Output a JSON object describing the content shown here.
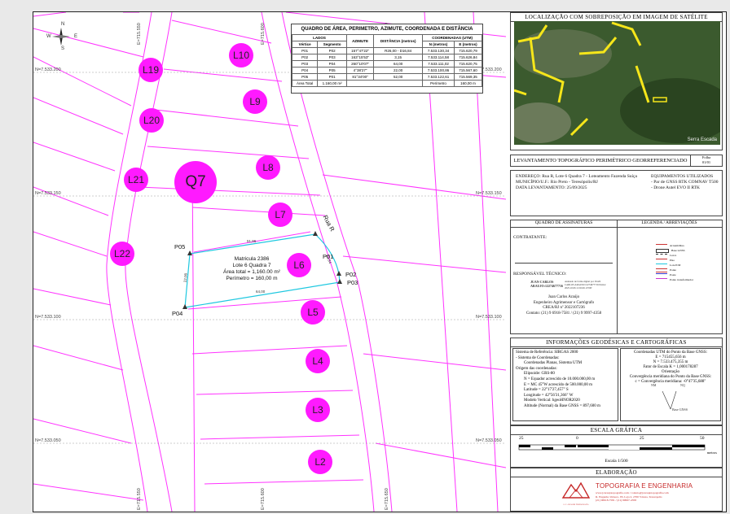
{
  "table": {
    "title": "QUADRO DE ÁREA, PERIMETRO, AZIMUTE, COORDENADA E DISTÂNCIA",
    "group_lados": "LADOS",
    "group_coords": "COORDENADAS (UTM)",
    "h_vertice": "Vértice",
    "h_segmento": "Segmento",
    "h_azimute": "AZIMUTE",
    "h_distancia": "DISTÂNCIA (metros)",
    "h_n": "N (metros)",
    "h_e": "E (metros)",
    "rows": [
      [
        "P01",
        "P02",
        "157°47'22\"",
        "R26,00 - D16,84",
        "7.533.130,34",
        "715.620,79"
      ],
      [
        "P02",
        "P03",
        "163°15'53\"",
        "3,15",
        "7.533.114,58",
        "715.626,84"
      ],
      [
        "P03",
        "P04",
        "260°10'07\"",
        "64,00",
        "7.533.111,02",
        "715.620,75"
      ],
      [
        "P04",
        "P05",
        "4°38'27\"",
        "22,00",
        "7.533.100,86",
        "715.567,60"
      ],
      [
        "P05",
        "P01",
        "81°34'00\"",
        "52,00",
        "7.533.122,61",
        "715.569,35"
      ]
    ],
    "total_label": "Área Total",
    "total_area": "1.160,00 m²",
    "perimetro_label": "Perímetro",
    "perimetro": "160,00 m"
  },
  "map": {
    "lots": [
      "L10",
      "L19",
      "L9",
      "L20",
      "L8",
      "L21",
      "Q7",
      "L7",
      "L22",
      "L6",
      "L5",
      "L4",
      "L3",
      "L2"
    ],
    "street": "Rua R",
    "vertices": [
      "P01",
      "P02",
      "P03",
      "P04",
      "P05"
    ],
    "matricula": [
      "Matricula 2386",
      "Lote 6 Quadra 7",
      "Área total = 1,160.00 m²",
      "Perímetro = 160,00 m"
    ],
    "dists": [
      "51,96",
      "22,84",
      "64,00",
      "22,00"
    ],
    "grid_n": [
      "N=7.533.200",
      "N=7.533.150",
      "N=7.533.100",
      "N=7.533.050"
    ],
    "grid_e": [
      "E=715.550",
      "E=715.600",
      "E=715.650"
    ],
    "north": [
      "N",
      "S",
      "W",
      "E"
    ]
  },
  "panel": {
    "sat_title": "LOCALIZAÇÃO COM SOBREPOSIÇÃO EM IMAGEM DE SATÉLITE",
    "sat_caption": "Serra Escada",
    "levant_title": "LEVANTAMENTO TOPOGRÁFICO PERIMÉTRICO GEORREFERENCIADO",
    "folha_label": "Folha",
    "folha": "01/01",
    "endereco": "ENDEREÇO: Rua R, Lote 6 Quadra 7 - Loteamento Fazenda Suíça",
    "municipio": "MUNICÍPIO/U.F.: Rio Preto - Teresópolis/RJ",
    "data": "DATA LEVANTAMENTO: 25/09/2025",
    "equip_title": "EQUIPAMENTOS UTILIZADOS",
    "equip1": "- Par de GNSS RTK COMNAV T500",
    "equip2": "- Drone Autel EVO II RTK",
    "assin_title": "QUADRO DE ASSINATURAS",
    "legenda_title": "LEGENDA / ABREVIAÇÕES",
    "contratante": "CONTRATANTE:",
    "resp_tecnico": "RESPONSÁVEL TÉCNICO:",
    "sig_name": "JUAN CARLOS ARAUJO:12274677716",
    "sig_note": "Assinado de forma digital por JUAN CARLOS ARAUJO:12274677716 Dados: 2025.10.06 11:02:49 -03'00'",
    "signer": "Juan Carlos Araújo",
    "profession": "Engenheiro Agrimensor e Cartógrafo",
    "crea": "CREA/RJ nº 2022107236",
    "contato": "Contato: (21) 9 6918-7581 / (21) 9 9997-4358",
    "legend": [
      "Arruam/Rua",
      "Base GNSS",
      "Cerca",
      "Piso",
      "Lote P/M",
      "Ponte",
      "Poste",
      "Ponto transformador"
    ],
    "geo_title": "INFORMAÇÕES GEODÉSICAS E CARTOGRÁFICAS",
    "geo_left": [
      "Sistema de Referência: SIRGAS 2000",
      "- Sistema de Coordenadas:",
      "Coordenadas Planas, Sistema UTM",
      "Origem das coordenadas:",
      "Elipsoide: GRS-80",
      "N = Equador acrescido de 10.000.000,00 m",
      "E = MC 45°W acrescido de 500.000,00 m",
      "Latitude = 22°17'27,457\" S",
      "Longitude = 42°56'31,366\" W",
      "Modelo Vertical: hgeoHNOR2020",
      "Altitude (Normal) da Base GNSS = 897,600 m"
    ],
    "geo_right": [
      "Coordenadas UTM do Ponto da Base GNSS:",
      "E = 715455,656 m",
      "N = 7.533.475,355 m",
      "Fator de Escala K = 1,000178287",
      "Orientação",
      "Convergência meridiana do Ponto da Base GNSS:",
      "c = Convergência meridiana: -0°47'35,688\""
    ],
    "geo_arrows": [
      "NM",
      "NQ",
      "Base GNSS"
    ],
    "escala_title": "ESCALA GRÁFICA",
    "escala_ticks": [
      "25",
      "0",
      "25",
      "50"
    ],
    "escala_unit": "metros",
    "escala_text": "Escala 1/500",
    "elab_title": "ELABORAÇÃO",
    "company": "TOPOGRAFIA E ENGENHARIA",
    "company_lines": [
      "www.jcaraujotopografia.com / contato@jcaraujotopografia.com",
      "R. Engenho Velasco, 83, Loja 2, 2700 Várzea, Teresópolis",
      "(21) 96918-7581 / (21) 99997-4358"
    ],
    "company_short": "J. C. ARAUJO TOPOGRAFIA"
  }
}
